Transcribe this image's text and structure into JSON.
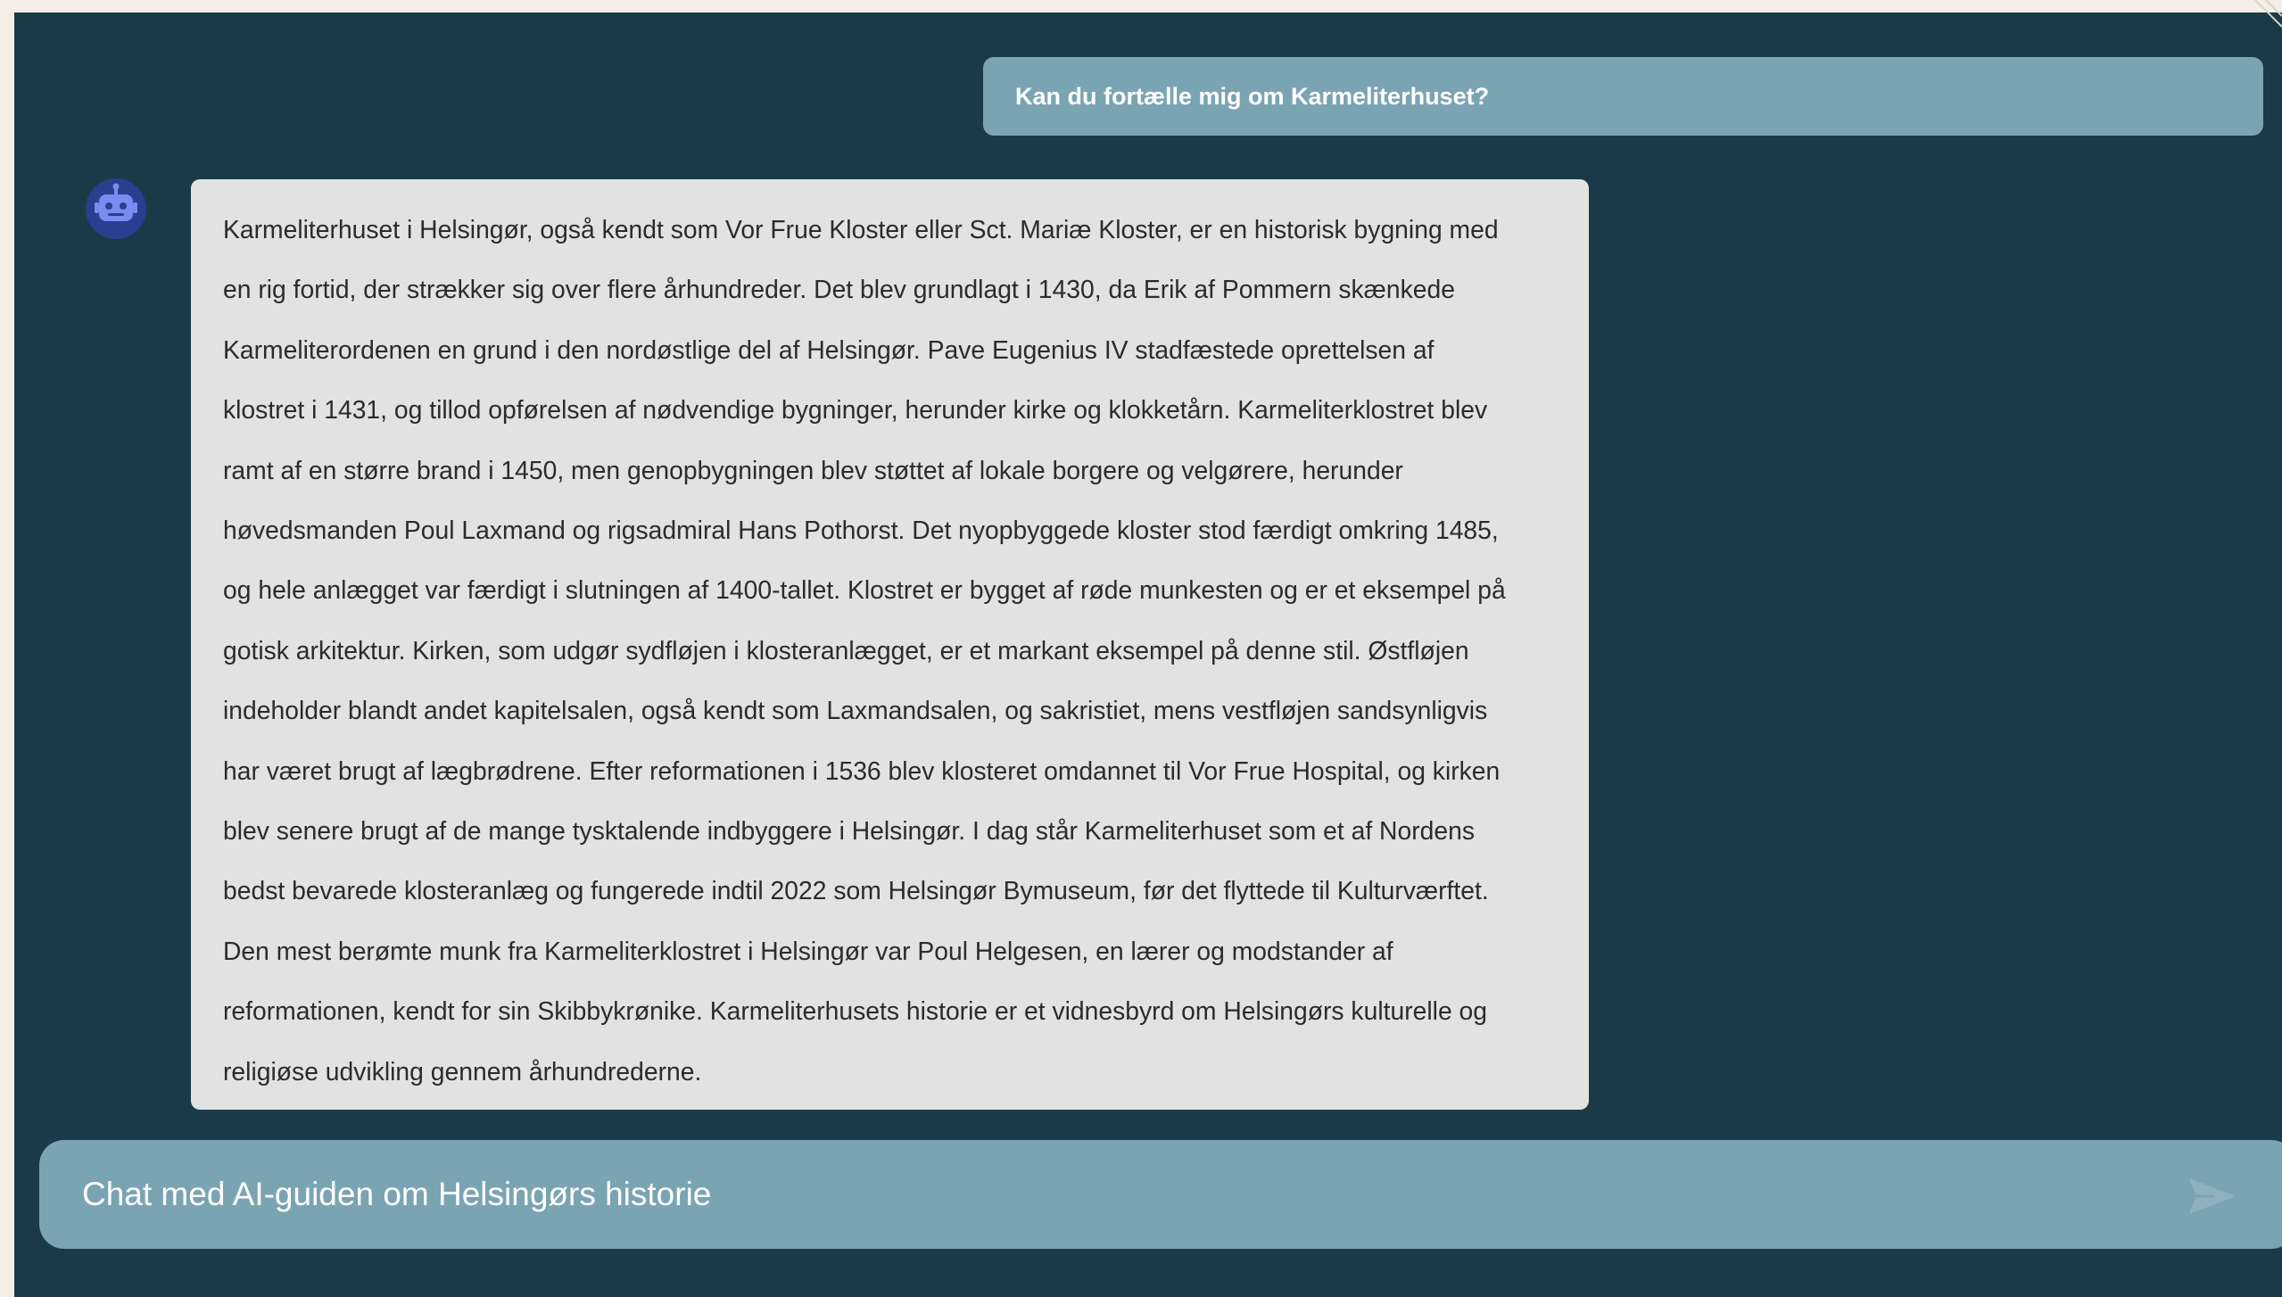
{
  "conversation": {
    "user_message": "Kan du fortælle mig om Karmeliterhuset?",
    "bot_message_lines": [
      "Karmeliterhuset i Helsingør, også kendt som Vor Frue Kloster eller Sct. Mariæ Kloster, er en historisk bygning med",
      "en rig fortid, der strækker sig over flere århundreder. Det blev grundlagt i 1430, da Erik af Pommern skænkede",
      "Karmeliterordenen en grund i den nordøstlige del af Helsingør. Pave Eugenius IV stadfæstede oprettelsen af",
      "klostret i 1431, og tillod opførelsen af nødvendige bygninger, herunder kirke og klokketårn. Karmeliterklostret blev",
      "ramt af en større brand i 1450, men genopbygningen blev støttet af lokale borgere og velgørere, herunder",
      "høvedsmanden Poul Laxmand og rigsadmiral Hans Pothorst. Det nyopbyggede kloster stod færdigt omkring 1485,",
      "og hele anlægget var færdigt i slutningen af 1400-tallet. Klostret er bygget af røde munkesten og er et eksempel på",
      "gotisk arkitektur. Kirken, som udgør sydfløjen i klosteranlægget, er et markant eksempel på denne stil. Østfløjen",
      "indeholder blandt andet kapitelsalen, også kendt som Laxmandsalen, og sakristiet, mens vestfløjen sandsynligvis",
      "har været brugt af lægbrødrene. Efter reformationen i 1536 blev klosteret omdannet til Vor Frue Hospital, og kirken",
      "blev senere brugt af de mange tysktalende indbyggere i Helsingør. I dag står Karmeliterhuset som et af Nordens",
      "bedst bevarede klosteranlæg og fungerede indtil 2022 som Helsingør Bymuseum, før det flyttede til Kulturværftet.",
      "Den mest berømte munk fra Karmeliterklostret i Helsingør var Poul Helgesen, en lærer og modstander af",
      "reformationen, kendt for sin Skibbykrønike. Karmeliterhusets historie er et vidnesbyrd om Helsingørs kulturelle og",
      "religiøse udvikling gennem århundrederne."
    ]
  },
  "composer": {
    "placeholder": "Chat med AI-guiden om Helsingørs historie"
  },
  "icons": {
    "avatar": "robot-icon",
    "send": "send-icon"
  },
  "colors": {
    "background": "#1b3a47",
    "user_bubble": "#7ba4b3",
    "bot_bubble": "#e2e2e2",
    "avatar": "#2c3e8f"
  }
}
